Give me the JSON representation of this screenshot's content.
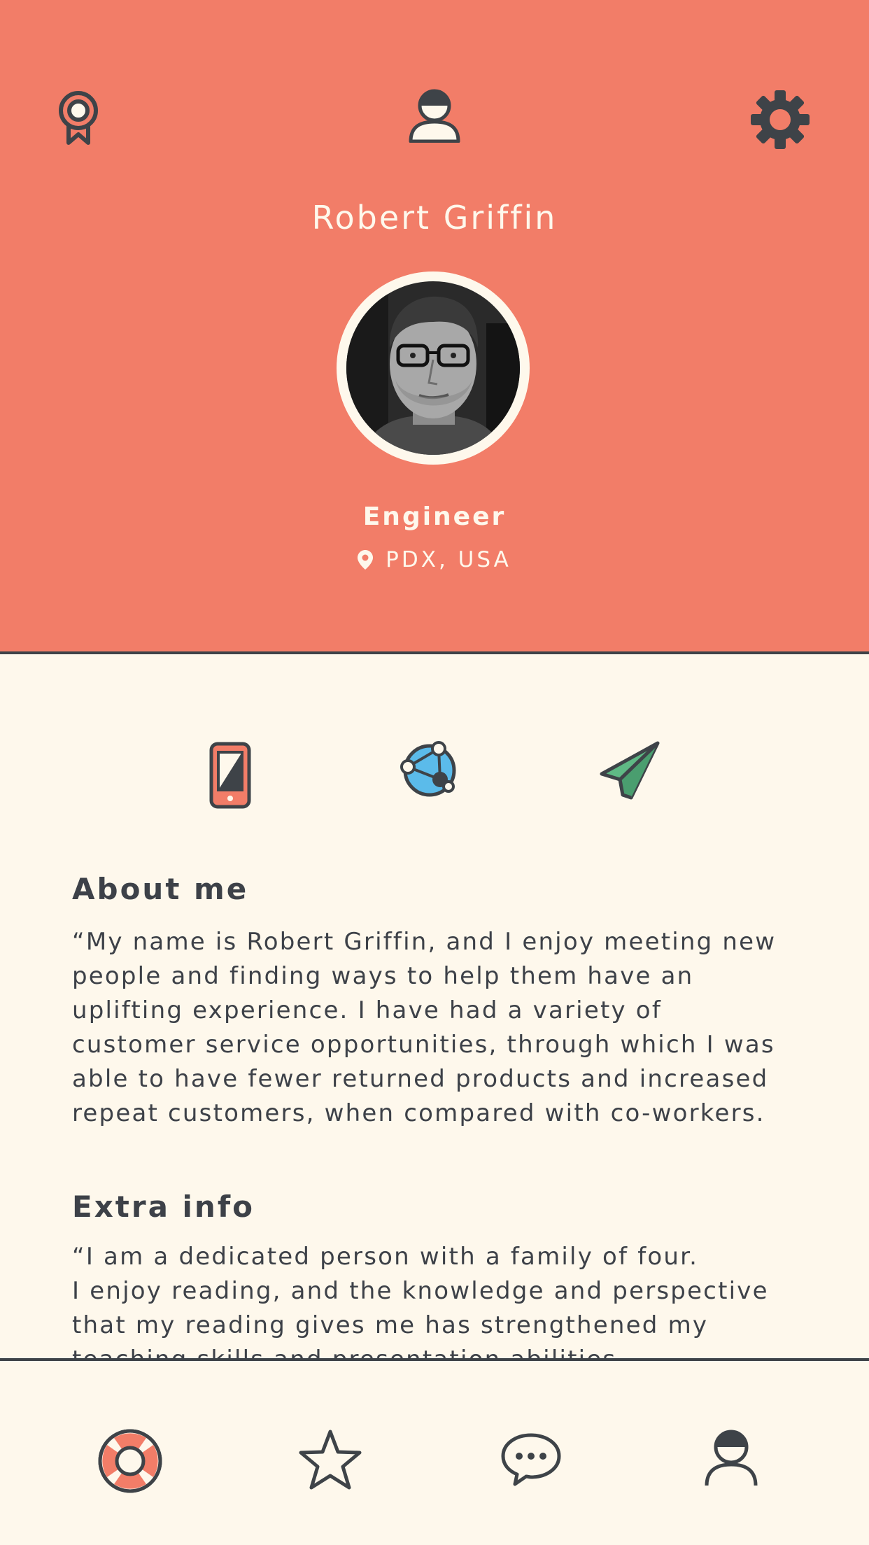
{
  "header": {
    "name": "Robert Griffin",
    "job_title": "Engineer",
    "location": "PDX, USA",
    "icons": {
      "left": "award-ribbon-icon",
      "center": "user-icon",
      "right": "gear-icon"
    }
  },
  "avatar": {
    "description_icon": "profile-photo"
  },
  "contact_actions": [
    {
      "icon": "phone-icon"
    },
    {
      "icon": "network-globe-icon"
    },
    {
      "icon": "paper-plane-icon"
    }
  ],
  "about": {
    "title": "About me",
    "body": "“My name is Robert Griffin, and I enjoy meeting new\npeople and finding ways to help them have an\nuplifting experience. I have had a variety of\ncustomer service opportunities, through which I was\nable to have fewer returned products and increased\nrepeat customers, when compared with co-workers."
  },
  "extra": {
    "title": "Extra info",
    "body": "“I am a dedicated person with a family of four.\nI enjoy reading, and the knowledge and perspective\nthat my reading gives me has strengthened my\nteaching skills and presentation abilities."
  },
  "tabbar": [
    {
      "icon": "lifebuoy-icon"
    },
    {
      "icon": "star-icon"
    },
    {
      "icon": "chat-bubble-icon"
    },
    {
      "icon": "user-icon"
    }
  ],
  "colors": {
    "header_bg": "#F27D68",
    "page_bg": "#FEF8EC",
    "text_dark": "#3D4148",
    "accent_blue": "#5BBBEA",
    "accent_green": "#5FB985"
  }
}
